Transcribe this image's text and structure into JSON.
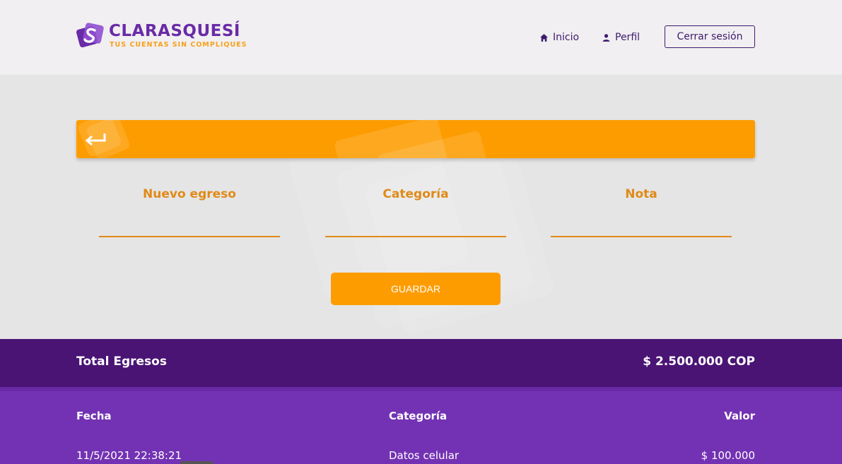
{
  "brand": {
    "name": "CLARASQUESÍ",
    "tagline": "TUS CUENTAS SIN COMPLIQUES",
    "colors": {
      "purple": "#6a2ba7",
      "orange": "#fd9c00",
      "dark_purple": "#4a1475"
    }
  },
  "nav": {
    "inicio": {
      "label": "Inicio",
      "icon": "home-icon"
    },
    "perfil": {
      "label": "Perfil",
      "icon": "person-icon"
    },
    "logout_label": "Cerrar sesión"
  },
  "toolbar": {
    "back_icon": "return-arrow-icon"
  },
  "form": {
    "fields": [
      {
        "label": "Nuevo egreso",
        "value": "",
        "placeholder": ""
      },
      {
        "label": "Categoría",
        "value": "",
        "placeholder": ""
      },
      {
        "label": "Nota",
        "value": "",
        "placeholder": ""
      }
    ],
    "save_label": "GUARDAR"
  },
  "summary": {
    "total_label": "Total Egresos",
    "total_value": "$ 2.500.000 COP"
  },
  "table": {
    "headers": [
      "Fecha",
      "Categoría",
      "Valor"
    ],
    "rows": [
      [
        "11/5/2021 22:38:21",
        "Datos celular",
        "$ 100.000"
      ]
    ]
  }
}
